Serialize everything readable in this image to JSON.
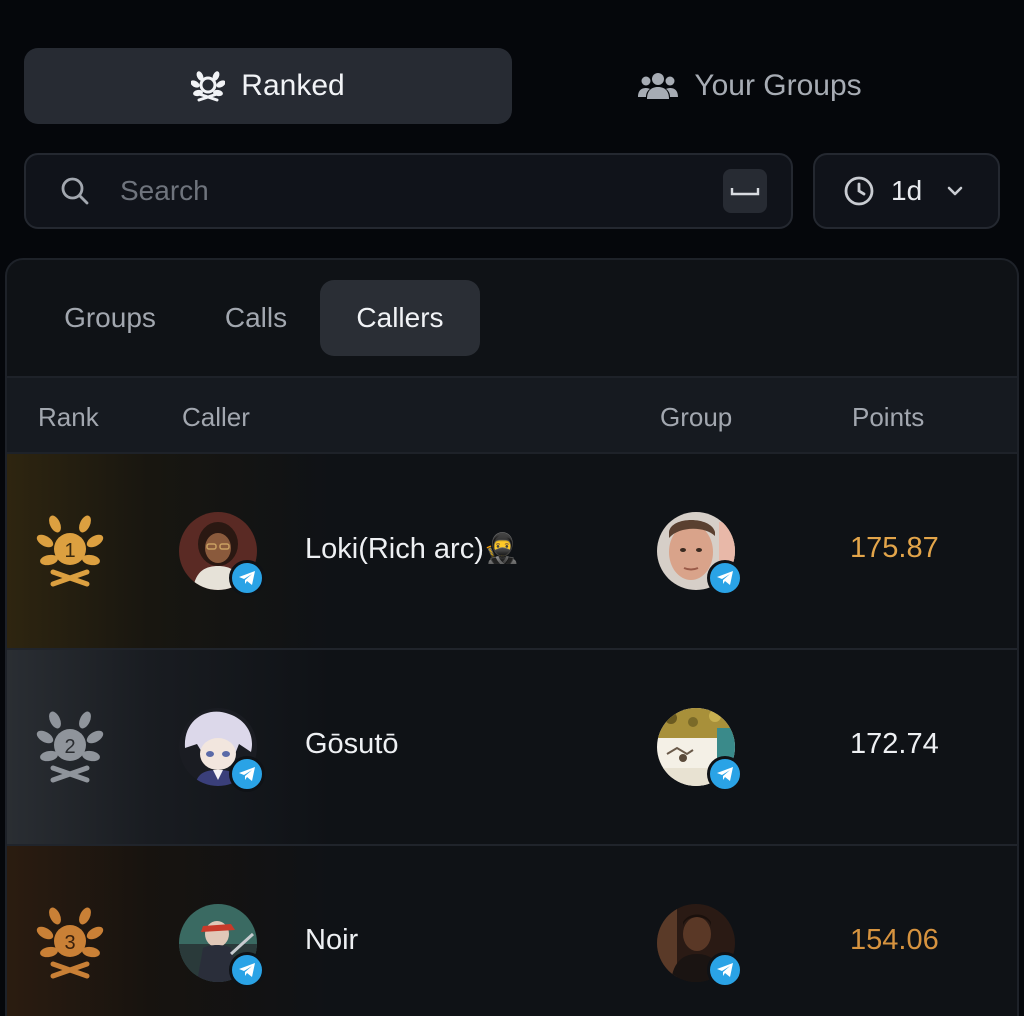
{
  "mode_tabs": {
    "ranked": "Ranked",
    "your_groups": "Your Groups"
  },
  "search": {
    "placeholder": "Search",
    "shortcut_icon": "space-key-icon"
  },
  "time_filter": {
    "value": "1d"
  },
  "sub_tabs": [
    "Groups",
    "Calls",
    "Callers"
  ],
  "active_sub_tab": "Callers",
  "table": {
    "headers": {
      "rank": "Rank",
      "caller": "Caller",
      "group": "Group",
      "points": "Points"
    },
    "rows": [
      {
        "rank": "1",
        "caller": "Loki(Rich arc)🥷",
        "points": "175.87",
        "tier": "gold",
        "points_color": "#e3a54a"
      },
      {
        "rank": "2",
        "caller": "Gōsutō",
        "points": "172.74",
        "tier": "silver",
        "points_color": "#eef0f3"
      },
      {
        "rank": "3",
        "caller": "Noir",
        "points": "154.06",
        "tier": "bronze",
        "points_color": "#d6933f"
      }
    ]
  },
  "colors": {
    "gold": "#dca040",
    "silver": "#8f949b",
    "bronze": "#c98036",
    "telegram": "#2aa3e6"
  }
}
